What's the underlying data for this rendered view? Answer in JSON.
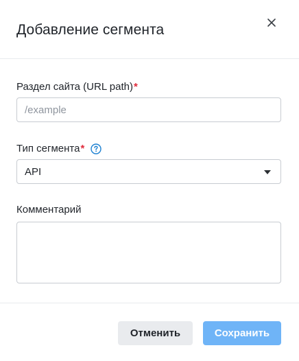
{
  "dialog": {
    "title": "Добавление сегмента",
    "close_icon": "close-icon"
  },
  "fields": {
    "url_path": {
      "label": "Раздел сайта (URL path)",
      "required_mark": "*",
      "placeholder": "/example",
      "value": ""
    },
    "segment_type": {
      "label": "Тип сегмента",
      "required_mark": "*",
      "help_icon": "question-circle-icon",
      "selected": "API",
      "caret_icon": "caret-down-icon"
    },
    "comment": {
      "label": "Комментарий",
      "value": ""
    }
  },
  "footer": {
    "cancel_label": "Отменить",
    "save_label": "Сохранить"
  },
  "colors": {
    "accent": "#6fb4f7",
    "required": "#e02b3b",
    "help_icon": "#1a7fd1",
    "border": "#c7cbd1"
  }
}
